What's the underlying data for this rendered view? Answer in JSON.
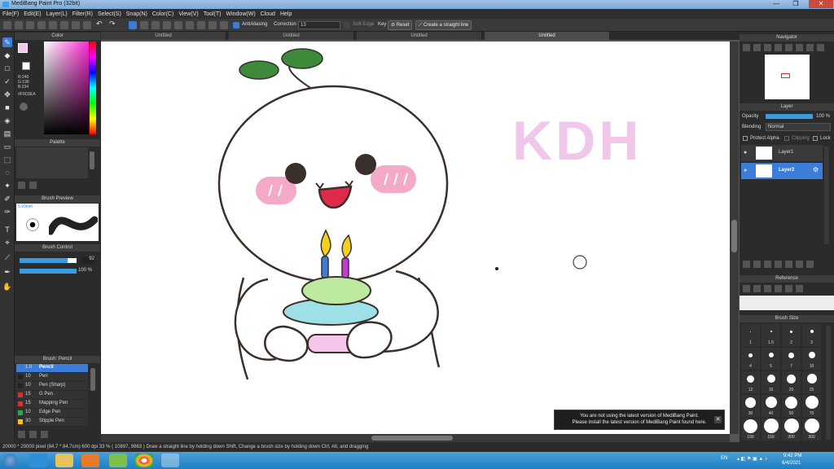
{
  "window": {
    "title": "MediBang Paint Pro (32bit)",
    "minimize": "—",
    "maximize": "❐",
    "close": "✕"
  },
  "menu": [
    "File(F)",
    "Edit(E)",
    "Layer(L)",
    "Filter(R)",
    "Select(S)",
    "Snap(N)",
    "Color(C)",
    "View(V)",
    "Tool(T)",
    "Window(W)",
    "Cloud",
    "Help"
  ],
  "toolbar": {
    "antialiasing_label": "AntiAliasing",
    "correction_label": "Correction",
    "correction_value": "13",
    "soft_edge_label": "Soft Edge",
    "key_label": "Key",
    "reset_label": "Reset",
    "straight_line_label": "Create a straight line"
  },
  "tabs": [
    "Untitled",
    "Untitled",
    "Untitled",
    "Untitled"
  ],
  "left_panel": {
    "color_title": "Color",
    "color_values": [
      "R:240",
      "G:198",
      "B:234"
    ],
    "color_hex": "#F0C6EA",
    "palette_title": "Palette",
    "brush_preview_title": "Brush Preview",
    "brush_preview_size": "5.93mm",
    "brush_control_title": "Brush Control",
    "brush_size_value": "92",
    "brush_opacity_value": "100 %",
    "brush_size_fraction": 0.84,
    "brush_opacity_fraction": 1.0,
    "brush_list_title": "Brush: Pencil",
    "brushes": [
      {
        "size": "1.0",
        "name": "Pencil",
        "color": "#3b7dd8",
        "selected": true
      },
      {
        "size": "10",
        "name": "Pen",
        "color": "#222222",
        "selected": false
      },
      {
        "size": "10",
        "name": "Pen (Sharp)",
        "color": "#222222",
        "selected": false
      },
      {
        "size": "15",
        "name": "G Pen",
        "color": "#d9302c",
        "selected": false
      },
      {
        "size": "15",
        "name": "Mapping Pen",
        "color": "#d9302c",
        "selected": false
      },
      {
        "size": "10",
        "name": "Edge Pen",
        "color": "#2aa84a",
        "selected": false
      },
      {
        "size": "30",
        "name": "Stipple Pen",
        "color": "#f0c419",
        "selected": false
      }
    ]
  },
  "canvas": {
    "artwork_text": "KDH",
    "notice_line1": "You are not using the latest version of MediBang Paint.",
    "notice_line2": "Please install the latest version of MediBang Paint found here."
  },
  "right_panel": {
    "navigator_title": "Navigator",
    "layer_title": "Layer",
    "opacity_label": "Opacity",
    "opacity_value": "100 %",
    "opacity_fraction": 1.0,
    "blending_label": "Blending",
    "blending_value": "Normal",
    "protect_alpha_label": "Protect Alpha",
    "clipping_label": "Clipping",
    "lock_label": "Lock",
    "layers": [
      "Layer1",
      "Layer2"
    ],
    "reference_title": "Reference",
    "brush_size_title": "Brush Size",
    "brush_sizes": [
      "1",
      "1.5",
      "2",
      "3",
      "4",
      "5",
      "7",
      "10",
      "12",
      "15",
      "20",
      "25",
      "30",
      "40",
      "50",
      "70",
      "100",
      "150",
      "200",
      "300"
    ]
  },
  "status_text": "20000 * 20000 pixel   (84.7 * 84.7cm)   600 dpi   33 %   ( 10897, 9863 )   Draw a straight line by holding down Shift, Change a brush size by holding down Ctrl, Alt, and dragging",
  "taskbar": {
    "lang": "EN",
    "time": "9:42 PM",
    "date": "6/4/2021"
  }
}
